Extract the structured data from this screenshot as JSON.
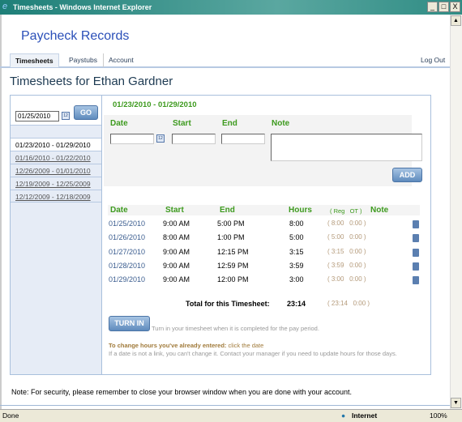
{
  "window": {
    "title": "Timesheets - Windows Internet Explorer",
    "buttons": [
      "_",
      "□",
      "X"
    ]
  },
  "brand": "Paycheck Records",
  "tabs": [
    {
      "label": "Timesheets",
      "active": true
    },
    {
      "label": "Paystubs"
    },
    {
      "label": "Account"
    }
  ],
  "logout": "Log Out",
  "heading": "Timesheets for Ethan Gardner",
  "sidebar": {
    "date_value": "01/25/2010",
    "go_label": "GO",
    "periods": [
      "01/23/2010 - 01/29/2010",
      "01/16/2010 - 01/22/2010",
      "12/26/2009 - 01/01/2010",
      "12/19/2009 - 12/25/2009",
      "12/12/2009 - 12/18/2009"
    ],
    "selected_index": 0
  },
  "form": {
    "period": "01/23/2010 - 01/29/2010",
    "date_label": "Date",
    "start_label": "Start",
    "end_label": "End",
    "note_label": "Note",
    "add_label": "ADD"
  },
  "table": {
    "headers": {
      "date": "Date",
      "start": "Start",
      "end": "End",
      "hours": "Hours",
      "reg_ot": "( Reg   OT )",
      "note": "Note"
    },
    "rows": [
      {
        "date": "01/25/2010",
        "start": "9:00 AM",
        "end": "5:00 PM",
        "hours": "8:00",
        "split": "( 8:00   0:00 )"
      },
      {
        "date": "01/26/2010",
        "start": "8:00 AM",
        "end": "1:00 PM",
        "hours": "5:00",
        "split": "( 5:00   0:00 )"
      },
      {
        "date": "01/27/2010",
        "start": "9:00 AM",
        "end": "12:15 PM",
        "hours": "3:15",
        "split": "( 3:15   0:00 )"
      },
      {
        "date": "01/28/2010",
        "start": "9:00 AM",
        "end": "12:59 PM",
        "hours": "3:59",
        "split": "( 3:59   0:00 )"
      },
      {
        "date": "01/29/2010",
        "start": "9:00 AM",
        "end": "12:00 PM",
        "hours": "3:00",
        "split": "( 3:00   0:00 )"
      }
    ],
    "total_label": "Total for this Timesheet:",
    "total": "23:14",
    "total_split": "( 23:14   0:00 )"
  },
  "turnin": {
    "label": "TURN IN",
    "hint": "Turn in your timesheet when it is completed for the pay period."
  },
  "help": {
    "bold": "To change hours you've already entered:",
    "rest": " click the date",
    "line2": "If a date is not a link, you can't change it. Contact your manager if you need to update hours for those days."
  },
  "footer_note": "Note: For security, please remember to close your browser window when you are done with your account.",
  "status": {
    "text": "Done",
    "zone": "Internet",
    "zoom": "100%"
  }
}
